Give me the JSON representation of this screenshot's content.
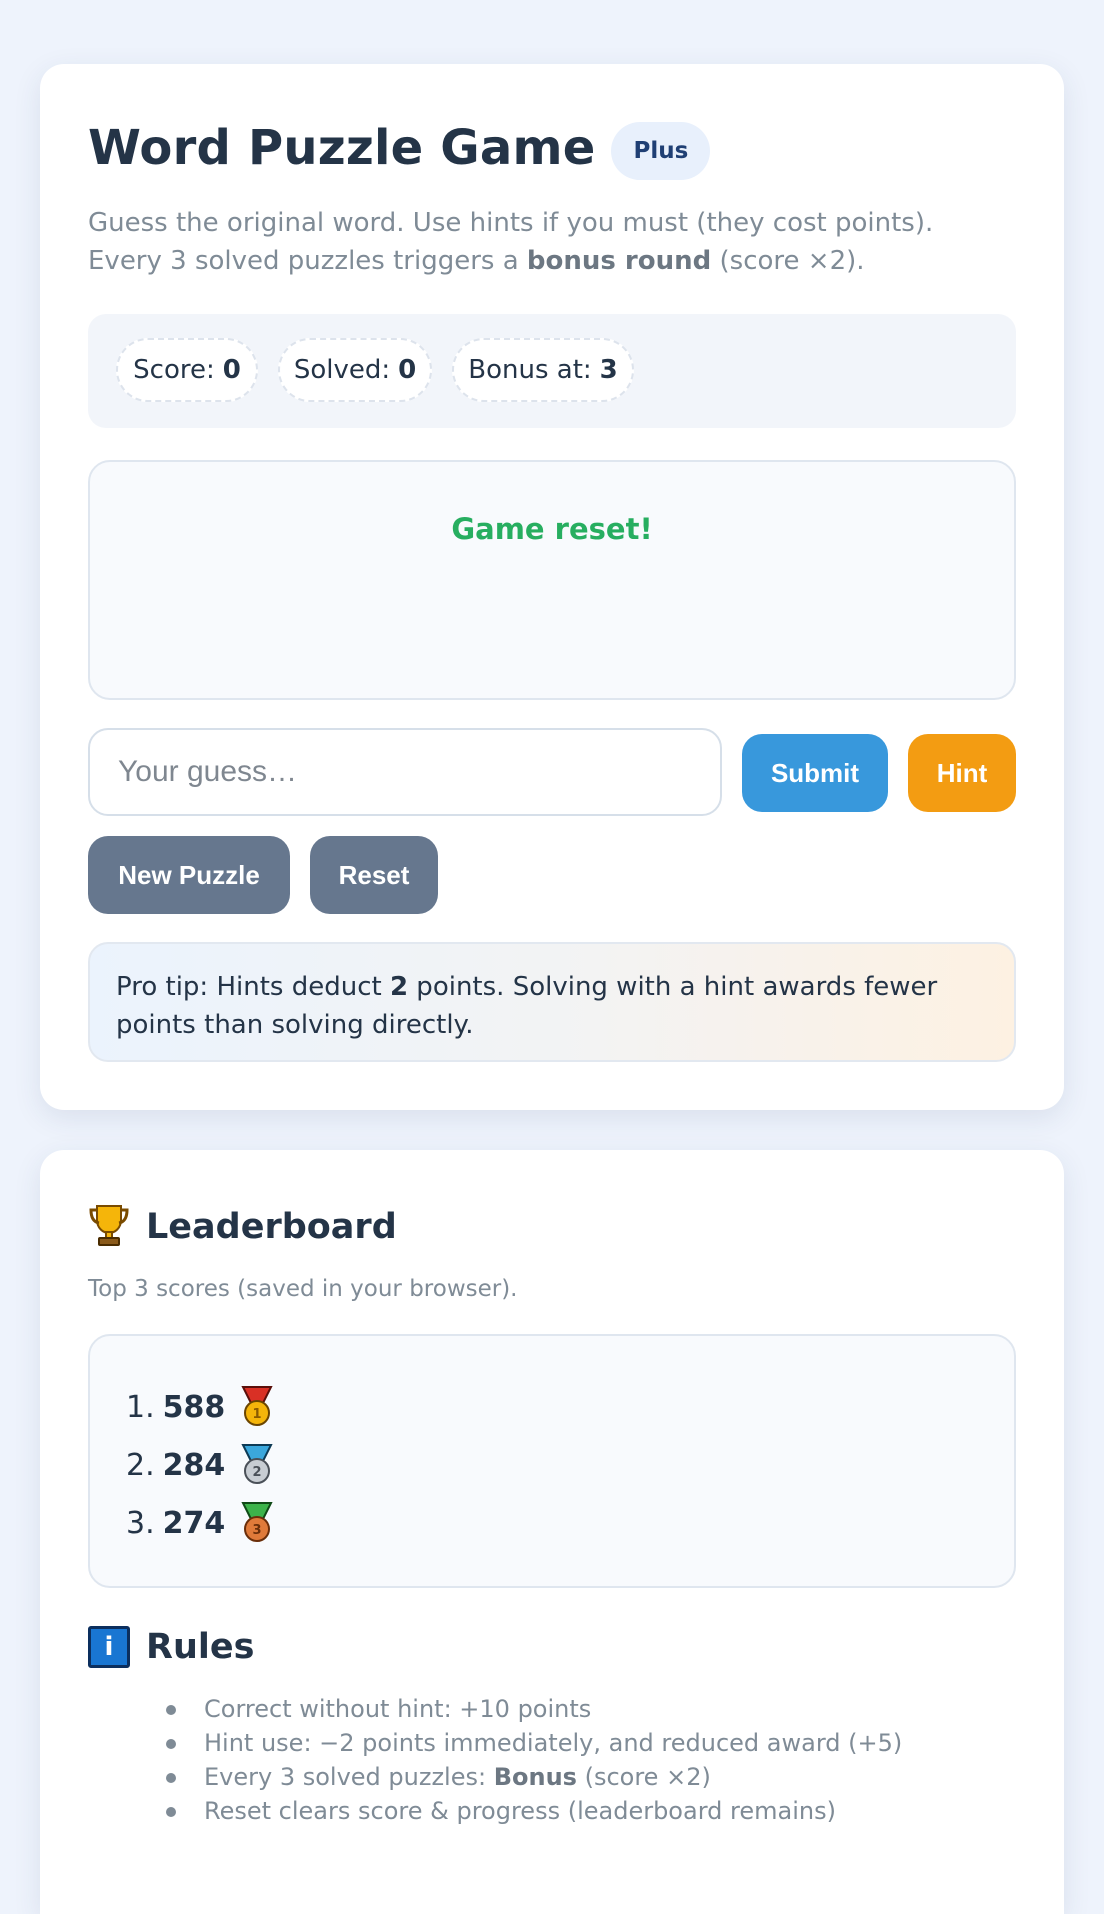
{
  "game": {
    "title": "Word Puzzle Game",
    "badge": "Plus",
    "description_parts": {
      "before": "Guess the original word. Use hints if you must (they cost points). Every 3 solved puzzles triggers a ",
      "bold": "bonus round",
      "after": " (score ×2)."
    },
    "stats": {
      "score_label": "Score:",
      "score_value": "0",
      "solved_label": "Solved:",
      "solved_value": "0",
      "bonus_label": "Bonus at:",
      "bonus_value": "3"
    },
    "message": "Game reset!",
    "message_color": "#27ae60",
    "guess_placeholder": "Your guess…",
    "guess_value": "",
    "buttons": {
      "submit": "Submit",
      "hint": "Hint",
      "new_puzzle": "New Puzzle",
      "reset": "Reset"
    },
    "button_colors": {
      "submit": "#3898dc",
      "hint": "#f39c12",
      "secondary": "#66778e"
    },
    "tip": {
      "before": "Pro tip: Hints deduct ",
      "bold": "2",
      "after": " points. Solving with a hint awards fewer points than solving directly."
    }
  },
  "leaderboard": {
    "icon": "trophy-icon",
    "title": "Leaderboard",
    "subtitle": "Top 3 scores (saved in your browser).",
    "entries": [
      {
        "rank": "1.",
        "score": "588",
        "medal": "gold-medal-icon"
      },
      {
        "rank": "2.",
        "score": "284",
        "medal": "silver-medal-icon"
      },
      {
        "rank": "3.",
        "score": "274",
        "medal": "bronze-medal-icon"
      }
    ]
  },
  "rules": {
    "icon": "info-icon",
    "icon_glyph": "i",
    "title": "Rules",
    "items": [
      {
        "text": "Correct without hint: +10 points"
      },
      {
        "text": "Hint use: −2 points immediately, and reduced award (+5)"
      },
      {
        "before": "Every 3 solved puzzles: ",
        "bold": "Bonus",
        "after": " (score ×2)"
      },
      {
        "text": "Reset clears score & progress (leaderboard remains)"
      }
    ]
  }
}
